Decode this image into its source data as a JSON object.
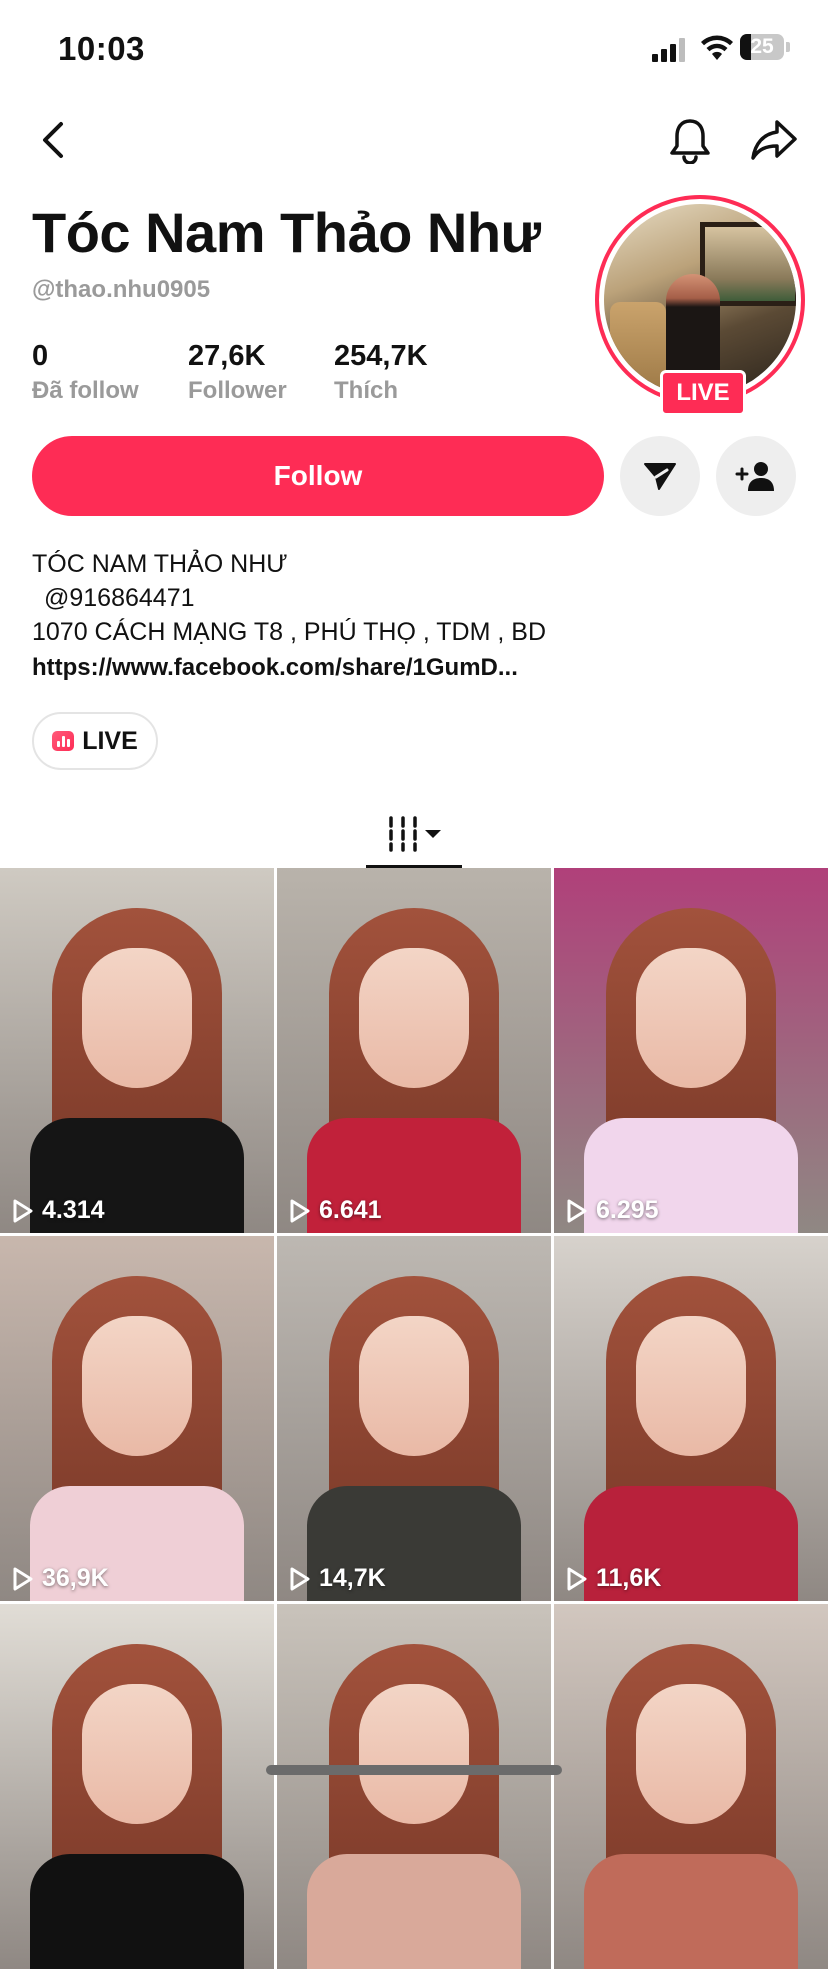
{
  "status": {
    "time": "10:03",
    "battery": "25"
  },
  "profile": {
    "name": "Tóc Nam Thảo Như",
    "handle": "@thao.nhu0905",
    "live_badge": "LIVE"
  },
  "stats": [
    {
      "value": "0",
      "label": "Đã follow"
    },
    {
      "value": "27,6K",
      "label": "Follower"
    },
    {
      "value": "254,7K",
      "label": "Thích"
    }
  ],
  "actions": {
    "follow_label": "Follow"
  },
  "bio": {
    "line1": "TÓC NAM THẢO NHƯ",
    "line2": "@916864471",
    "line3": "1070 CÁCH MẠNG T8 , PHÚ THỌ , TDM , BD",
    "link": "https://www.facebook.com/share/1GumD..."
  },
  "live_chip": {
    "label": "LIVE"
  },
  "videos": [
    {
      "views": "4.314",
      "bg": "#cfcac2",
      "outfit": "#151515"
    },
    {
      "views": "6.641",
      "bg": "#b9b3ab",
      "outfit": "#c1213a"
    },
    {
      "views": "6.295",
      "bg": "#b0407a",
      "outfit": "#f1d6ec"
    },
    {
      "views": "36,9K",
      "bg": "#c8b7ad",
      "outfit": "#efcfd6"
    },
    {
      "views": "14,7K",
      "bg": "#bdb8b2",
      "outfit": "#3a3a36"
    },
    {
      "views": "11,6K",
      "bg": "#d7d2cc",
      "outfit": "#b8213b"
    },
    {
      "views": "",
      "bg": "#e1ddd6",
      "outfit": "#111111"
    },
    {
      "views": "",
      "bg": "#c9c3bb",
      "outfit": "#d9a99a"
    },
    {
      "views": "",
      "bg": "#d2c7bf",
      "outfit": "#c06b5a"
    }
  ]
}
